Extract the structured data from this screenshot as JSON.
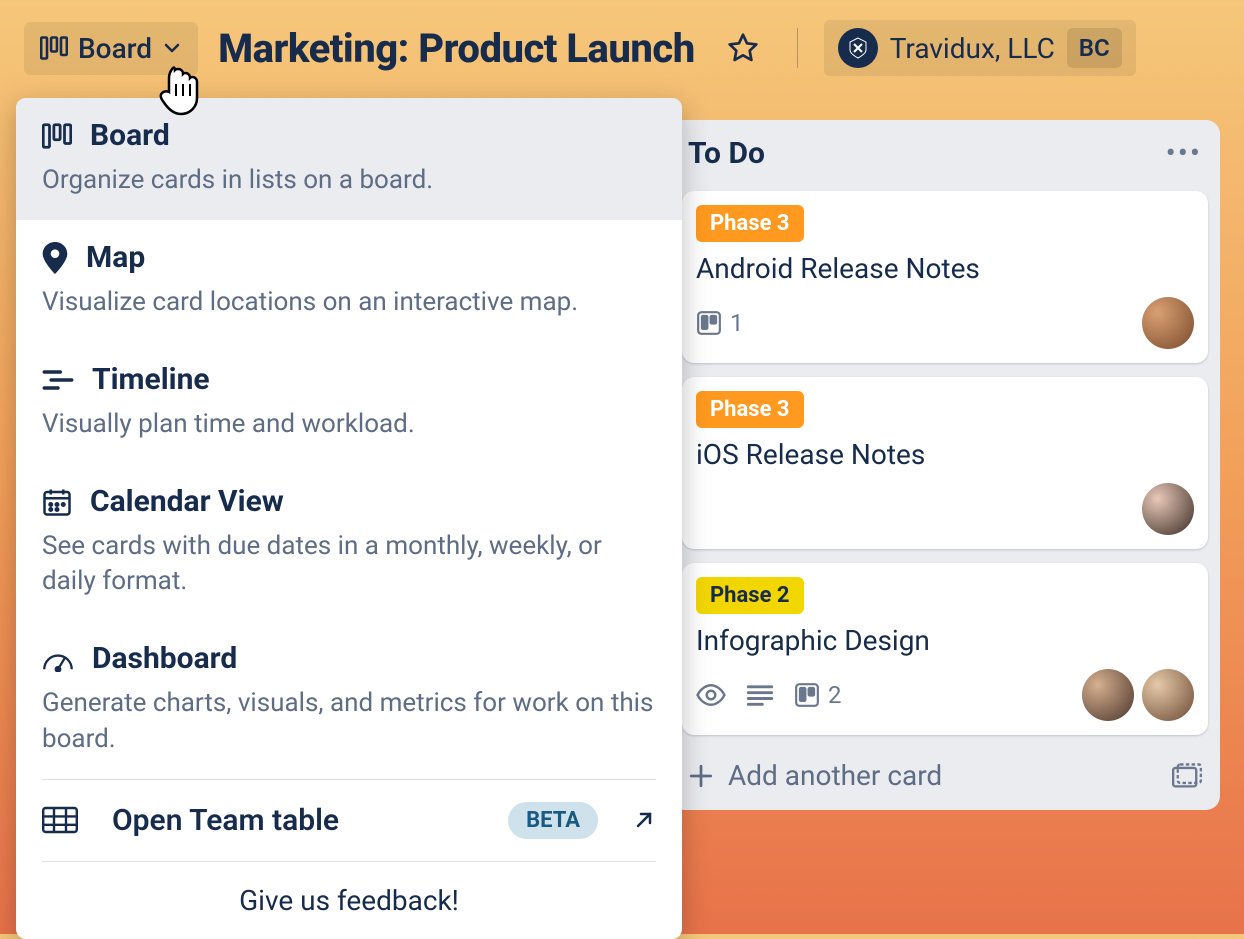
{
  "header": {
    "view_label": "Board",
    "board_title": "Marketing: Product Launch",
    "workspace_name": "Travidux, LLC",
    "user_initials": "BC"
  },
  "dropdown": {
    "items": [
      {
        "title": "Board",
        "desc": "Organize cards in lists on a board.",
        "icon": "board"
      },
      {
        "title": "Map",
        "desc": "Visualize card locations on an interactive map.",
        "icon": "map"
      },
      {
        "title": "Timeline",
        "desc": "Visually plan time and workload.",
        "icon": "timeline"
      },
      {
        "title": "Calendar View",
        "desc": "See cards with due dates in a monthly, weekly, or daily format.",
        "icon": "calendar"
      },
      {
        "title": "Dashboard",
        "desc": "Generate charts, visuals, and metrics for work on this board.",
        "icon": "dashboard"
      }
    ],
    "team_table_label": "Open Team table",
    "beta_label": "BETA",
    "feedback_label": "Give us feedback!"
  },
  "list": {
    "title": "To Do",
    "cards": [
      {
        "label_text": "Phase 3",
        "label_color": "orange",
        "title": "Android Release Notes",
        "trello_count": "1",
        "show_eye": false,
        "show_desc": false
      },
      {
        "label_text": "Phase 3",
        "label_color": "orange",
        "title": "iOS Release Notes",
        "trello_count": "",
        "show_eye": false,
        "show_desc": false
      },
      {
        "label_text": "Phase 2",
        "label_color": "yellow",
        "title": "Infographic Design",
        "trello_count": "2",
        "show_eye": true,
        "show_desc": true
      }
    ],
    "add_card_label": "Add another card"
  }
}
